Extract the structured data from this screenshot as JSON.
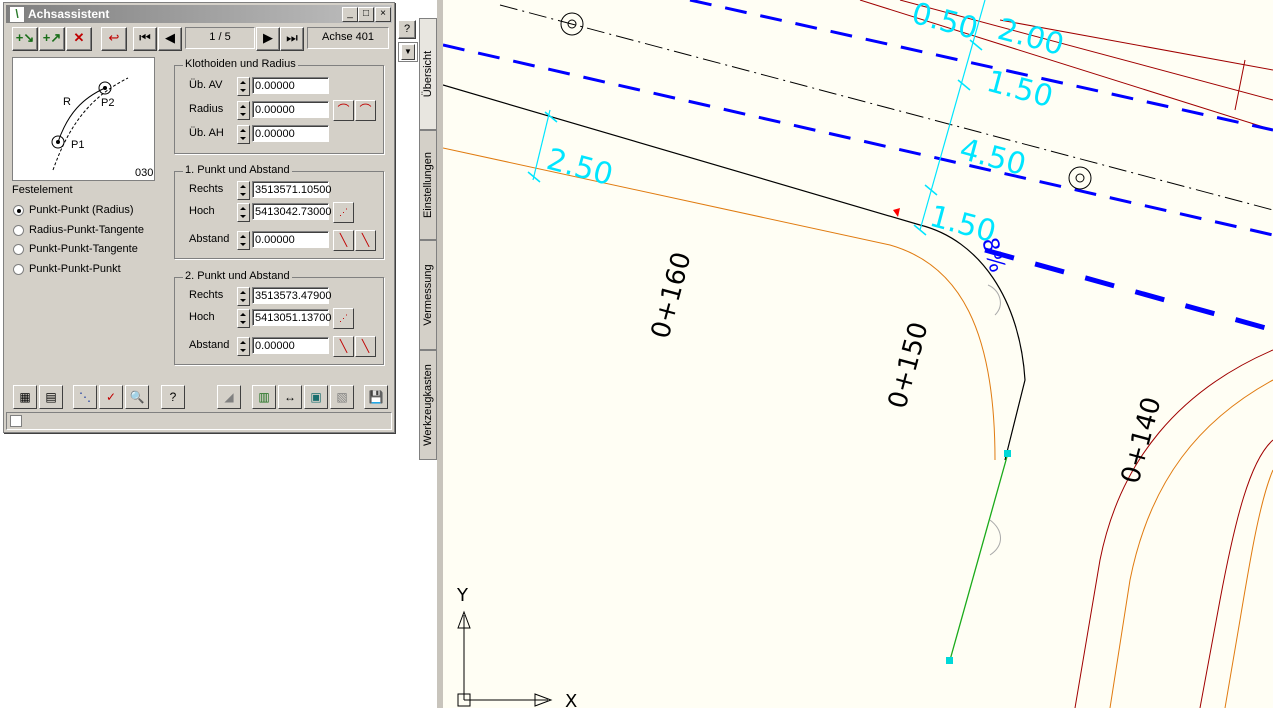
{
  "window": {
    "title": "Achsassistent",
    "minimize": "_",
    "maximize": "□",
    "close": "×"
  },
  "toolbar": {
    "page": "1 / 5",
    "axis": "Achse 401"
  },
  "preview": {
    "label_r": "R",
    "label_p1": "P1",
    "label_p2": "P2",
    "code": "030"
  },
  "festelement": {
    "title": "Festelement",
    "options": [
      "Punkt-Punkt (Radius)",
      "Radius-Punkt-Tangente",
      "Punkt-Punkt-Tangente",
      "Punkt-Punkt-Punkt"
    ],
    "selected": "Punkt-Punkt (Radius)"
  },
  "klothoiden": {
    "title": "Klothoiden und Radius",
    "ub_av_label": "Üb. AV",
    "ub_av": "0.00000",
    "radius_label": "Radius",
    "radius": "0.00000",
    "ub_ah_label": "Üb. AH",
    "ub_ah": "0.00000"
  },
  "punkt1": {
    "title": "1. Punkt und Abstand",
    "rechts_label": "Rechts",
    "rechts": "3513571.10500",
    "hoch_label": "Hoch",
    "hoch": "5413042.73000",
    "abstand_label": "Abstand",
    "abstand": "0.00000"
  },
  "punkt2": {
    "title": "2. Punkt und Abstand",
    "rechts_label": "Rechts",
    "rechts": "3513573.47900",
    "hoch_label": "Hoch",
    "hoch": "5413051.13700",
    "abstand_label": "Abstand",
    "abstand": "0.00000"
  },
  "side_tabs": [
    "Übersicht",
    "Einstellungen",
    "Vermessung",
    "Werkzeugkasten"
  ],
  "help": "?",
  "cad": {
    "dims": [
      "0.50",
      "2.00",
      "1.50",
      "4.50",
      "2.50",
      "1.50",
      "8%"
    ],
    "stations": [
      "0+160",
      "0+150",
      "0+140"
    ],
    "axis_x": "X",
    "axis_y": "Y"
  },
  "colors": {
    "dim": "#00e5ff",
    "blue_line": "#0000ff",
    "kerb": "#e07b10",
    "parcel": "#a00000",
    "background": "#fffef4"
  }
}
